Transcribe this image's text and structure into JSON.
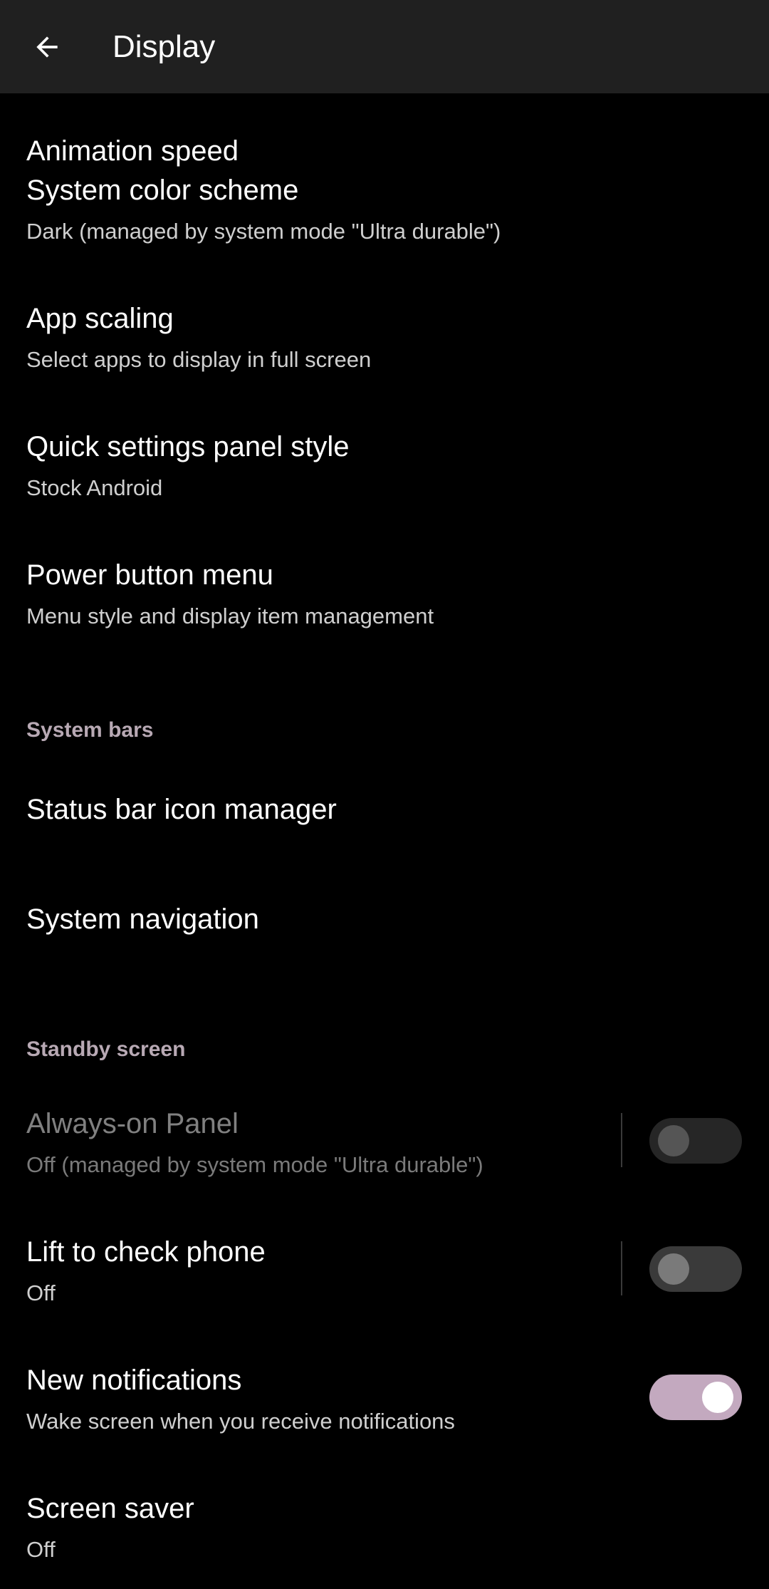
{
  "appbar": {
    "title": "Display",
    "back_icon": "arrow-left-icon"
  },
  "partial_item": {
    "title": "Animation speed"
  },
  "items_top": [
    {
      "title": "System color scheme",
      "summary": "Dark (managed by system mode \"Ultra durable\")"
    },
    {
      "title": "App scaling",
      "summary": "Select apps to display in full screen"
    },
    {
      "title": "Quick settings panel style",
      "summary": "Stock Android"
    },
    {
      "title": "Power button menu",
      "summary": "Menu style and display item management"
    }
  ],
  "system_bars": {
    "header": "System bars",
    "items": [
      {
        "title": "Status bar icon manager"
      },
      {
        "title": "System navigation"
      }
    ]
  },
  "standby": {
    "header": "Standby screen",
    "items": [
      {
        "title": "Always-on Panel",
        "summary": "Off (managed by system mode \"Ultra durable\")",
        "toggle": false,
        "enabled": false
      },
      {
        "title": "Lift to check phone",
        "summary": "Off",
        "toggle": false,
        "enabled": true
      },
      {
        "title": "New notifications",
        "summary": "Wake screen when you receive notifications",
        "toggle": true,
        "enabled": true
      },
      {
        "title": "Screen saver",
        "summary": "Off"
      }
    ]
  },
  "colors": {
    "background": "#000000",
    "appbar": "#202020",
    "accent": "#c3a9bf",
    "section_header": "#b8a9b4"
  }
}
